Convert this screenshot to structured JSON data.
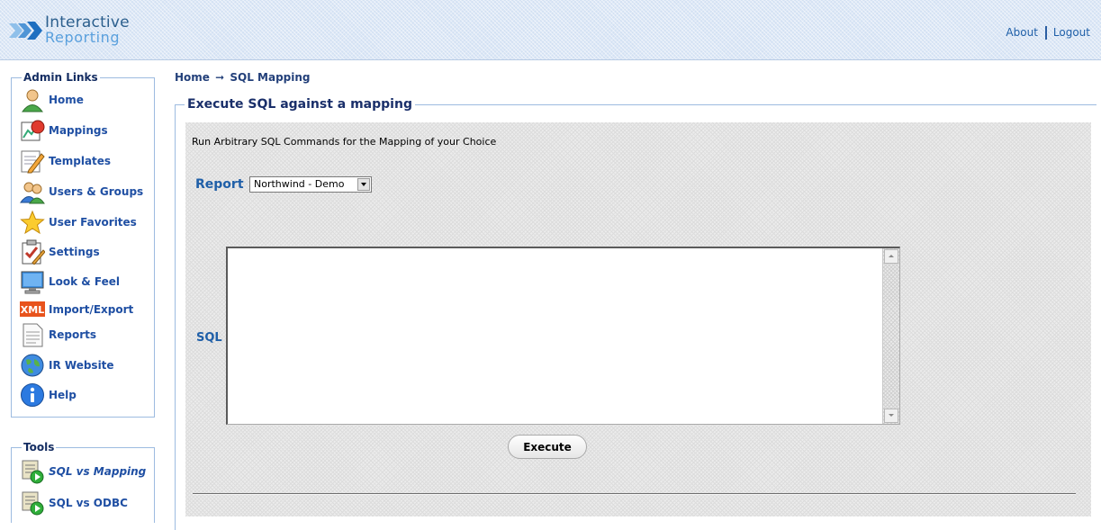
{
  "header": {
    "logo_line1": "Interactive",
    "logo_line2": "Reporting",
    "about_label": "About",
    "logout_label": "Logout"
  },
  "sidebar": {
    "admin_title": "Admin Links",
    "items": [
      {
        "label": "Home",
        "icon": "user-icon"
      },
      {
        "label": "Mappings",
        "icon": "mappings-icon"
      },
      {
        "label": "Templates",
        "icon": "pencil-icon"
      },
      {
        "label": "Users & Groups",
        "icon": "users-icon"
      },
      {
        "label": "User Favorites",
        "icon": "star-icon"
      },
      {
        "label": "Settings",
        "icon": "clipboard-icon"
      },
      {
        "label": "Look & Feel",
        "icon": "monitor-icon"
      },
      {
        "label": "Import/Export",
        "icon": "xml-icon"
      },
      {
        "label": "Reports",
        "icon": "document-icon"
      },
      {
        "label": "IR Website",
        "icon": "globe-icon"
      },
      {
        "label": "Help",
        "icon": "info-icon"
      }
    ],
    "tools_title": "Tools",
    "tools": [
      {
        "label": "SQL vs Mapping",
        "icon": "sql-tool-icon"
      },
      {
        "label": "SQL vs ODBC",
        "icon": "sql-tool-icon"
      }
    ]
  },
  "breadcrumb": {
    "home": "Home",
    "arrow": "➞",
    "current": "SQL Mapping"
  },
  "main": {
    "legend": "Execute SQL against a mapping",
    "description": "Run Arbitrary SQL Commands for the Mapping of your Choice",
    "report_label": "Report",
    "report_selected": "Northwind - Demo",
    "sql_label": "SQL",
    "sql_value": "",
    "execute_label": "Execute"
  },
  "colors": {
    "link": "#1f4fa3",
    "header_bg": "#d3e1f3",
    "border": "#9dbbe0"
  }
}
